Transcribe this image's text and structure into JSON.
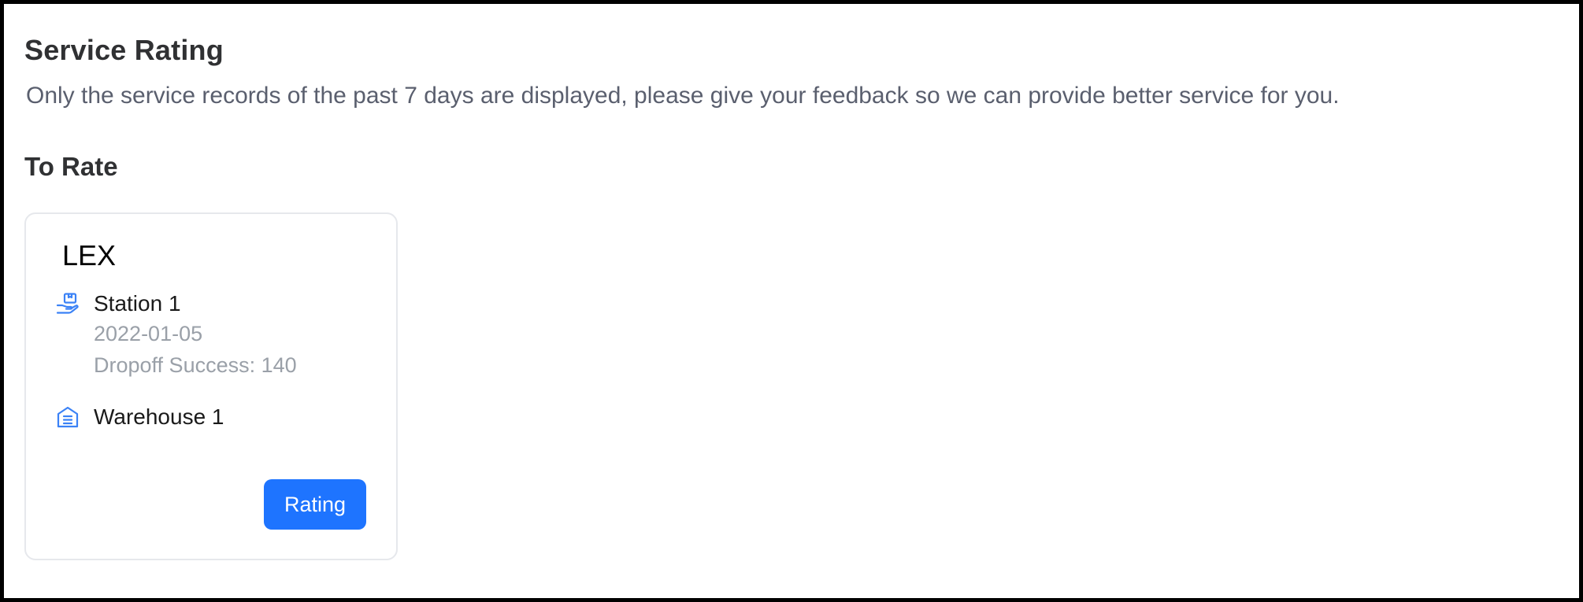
{
  "header": {
    "title": "Service Rating",
    "subtitle": "Only the service records of the past 7 days are displayed, please give your feedback so we can provide better service for you."
  },
  "section": {
    "title": "To Rate"
  },
  "cards": [
    {
      "title": "LEX",
      "station": {
        "icon": "hand-package-icon",
        "name": "Station 1",
        "date": "2022-01-05",
        "status": "Dropoff Success: 140"
      },
      "warehouse": {
        "icon": "warehouse-icon",
        "name": "Warehouse 1"
      },
      "button_label": "Rating"
    }
  ],
  "colors": {
    "accent": "#1e74ff",
    "icon": "#3b82f6",
    "muted_text": "#9aa0a8",
    "card_border": "#e6e8ec"
  }
}
